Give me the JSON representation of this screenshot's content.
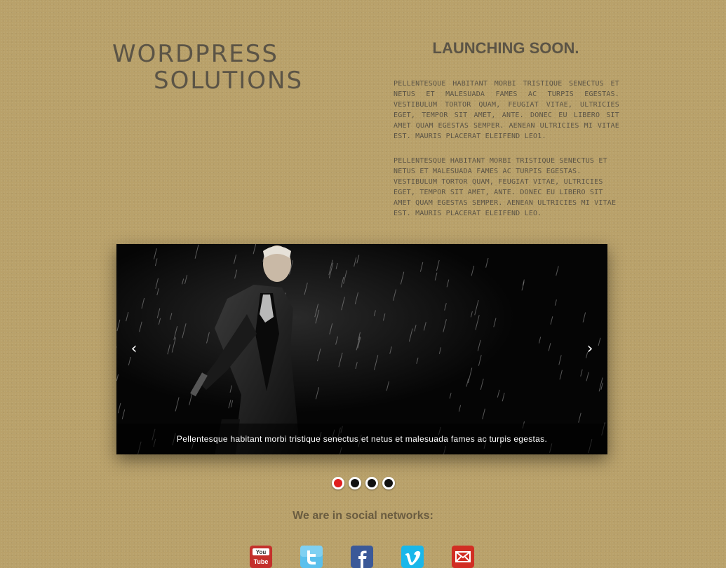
{
  "logo": {
    "line1": "WORDPRESS",
    "line2": "SOLUTIONS"
  },
  "launch": {
    "title": "LAUNCHING SOON.",
    "paragraph1": "Pellentesque habitant morbi tristique senectus et netus et malesuada fames ac turpis egestas. Vestibulum tortor quam, feugiat vitae, ultricies eget, tempor sit amet, ante. Donec eu libero sit amet quam egestas semper. Aenean ultricies mi vitae est. Mauris placerat eleifend leo1.",
    "paragraph2": "Pellentesque habitant morbi tristique senectus et netus et malesuada fames ac turpis egestas. Vestibulum tortor quam, feugiat vitae, ultricies eget, tempor sit amet, ante. Donec eu libero sit amet quam egestas semper. Aenean ultricies mi vitae est. Mauris placerat eleifend leo."
  },
  "slider": {
    "prev_glyph": "‹",
    "next_glyph": "›",
    "caption": "Pellentesque habitant morbi tristique senectus et netus et malesuada fames ac turpis egestas.",
    "active_slide": 1,
    "slide_count": 4
  },
  "social": {
    "heading": "We are in social networks:",
    "youtube_label": "You Tube",
    "icons": [
      "youtube-icon",
      "twitter-icon",
      "facebook-icon",
      "vimeo-icon",
      "email-icon"
    ]
  },
  "colors": {
    "background": "#b9a16a",
    "text": "#5b5446",
    "dot_active": "#e01e1e",
    "dot_inactive": "#111111",
    "youtube": "#c4302b",
    "twitter": "#5bc0ec",
    "facebook": "#3b5998",
    "vimeo": "#1ab7ea",
    "email": "#d12e23"
  }
}
